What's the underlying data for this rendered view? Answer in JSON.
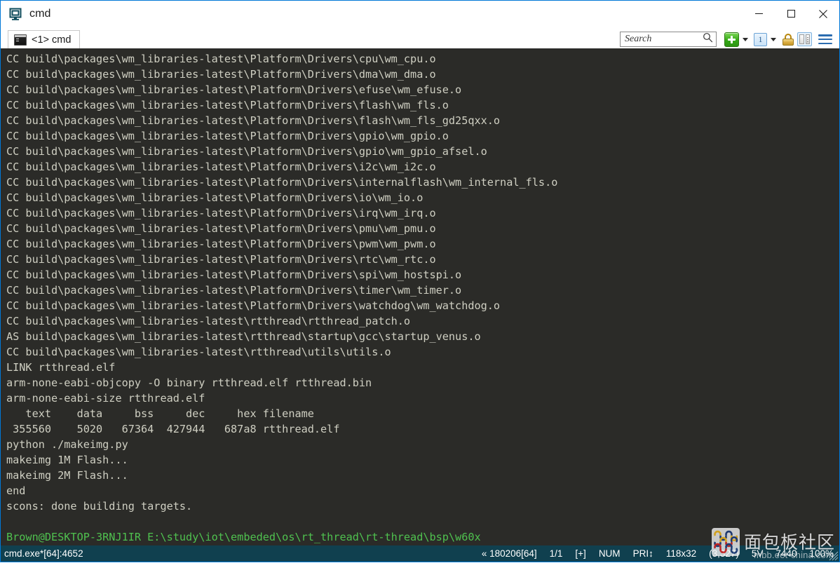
{
  "window": {
    "title": "cmd",
    "app_icon": "console-app-icon",
    "controls": {
      "minimize": "minimize-button",
      "maximize": "maximize-button",
      "close": "close-button"
    }
  },
  "tabs": [
    {
      "label": "<1> cmd",
      "icon": "console-tab-icon",
      "active": true
    }
  ],
  "toolbar": {
    "search": {
      "placeholder": "Search",
      "value": "",
      "icon": "search-icon"
    },
    "buttons": [
      {
        "name": "new-console-button",
        "icon": "plus-icon",
        "label": ""
      },
      {
        "name": "new-console-dropdown",
        "icon": "chevron-down-icon",
        "label": ""
      },
      {
        "name": "active-console-button",
        "icon": "console-number-icon",
        "label": "1"
      },
      {
        "name": "active-console-dropdown",
        "icon": "chevron-down-icon",
        "label": ""
      },
      {
        "name": "lock-button",
        "icon": "lock-icon",
        "label": ""
      },
      {
        "name": "split-view-button",
        "icon": "split-panes-icon",
        "label": ""
      },
      {
        "name": "main-menu-button",
        "icon": "hamburger-menu-icon",
        "label": ""
      }
    ]
  },
  "terminal": {
    "colors": {
      "background": "#2b2b28",
      "foreground": "#cfcfc2",
      "prompt": "#4fc14f"
    },
    "lines": [
      {
        "text": "CC build\\packages\\wm_libraries-latest\\Platform\\Drivers\\cpu\\wm_cpu.o",
        "style": "normal"
      },
      {
        "text": "CC build\\packages\\wm_libraries-latest\\Platform\\Drivers\\dma\\wm_dma.o",
        "style": "normal"
      },
      {
        "text": "CC build\\packages\\wm_libraries-latest\\Platform\\Drivers\\efuse\\wm_efuse.o",
        "style": "normal"
      },
      {
        "text": "CC build\\packages\\wm_libraries-latest\\Platform\\Drivers\\flash\\wm_fls.o",
        "style": "normal"
      },
      {
        "text": "CC build\\packages\\wm_libraries-latest\\Platform\\Drivers\\flash\\wm_fls_gd25qxx.o",
        "style": "normal"
      },
      {
        "text": "CC build\\packages\\wm_libraries-latest\\Platform\\Drivers\\gpio\\wm_gpio.o",
        "style": "normal"
      },
      {
        "text": "CC build\\packages\\wm_libraries-latest\\Platform\\Drivers\\gpio\\wm_gpio_afsel.o",
        "style": "normal"
      },
      {
        "text": "CC build\\packages\\wm_libraries-latest\\Platform\\Drivers\\i2c\\wm_i2c.o",
        "style": "normal"
      },
      {
        "text": "CC build\\packages\\wm_libraries-latest\\Platform\\Drivers\\internalflash\\wm_internal_fls.o",
        "style": "normal"
      },
      {
        "text": "CC build\\packages\\wm_libraries-latest\\Platform\\Drivers\\io\\wm_io.o",
        "style": "normal"
      },
      {
        "text": "CC build\\packages\\wm_libraries-latest\\Platform\\Drivers\\irq\\wm_irq.o",
        "style": "normal"
      },
      {
        "text": "CC build\\packages\\wm_libraries-latest\\Platform\\Drivers\\pmu\\wm_pmu.o",
        "style": "normal"
      },
      {
        "text": "CC build\\packages\\wm_libraries-latest\\Platform\\Drivers\\pwm\\wm_pwm.o",
        "style": "normal"
      },
      {
        "text": "CC build\\packages\\wm_libraries-latest\\Platform\\Drivers\\rtc\\wm_rtc.o",
        "style": "normal"
      },
      {
        "text": "CC build\\packages\\wm_libraries-latest\\Platform\\Drivers\\spi\\wm_hostspi.o",
        "style": "normal"
      },
      {
        "text": "CC build\\packages\\wm_libraries-latest\\Platform\\Drivers\\timer\\wm_timer.o",
        "style": "normal"
      },
      {
        "text": "CC build\\packages\\wm_libraries-latest\\Platform\\Drivers\\watchdog\\wm_watchdog.o",
        "style": "normal"
      },
      {
        "text": "CC build\\packages\\wm_libraries-latest\\rtthread\\rtthread_patch.o",
        "style": "normal"
      },
      {
        "text": "AS build\\packages\\wm_libraries-latest\\rtthread\\startup\\gcc\\startup_venus.o",
        "style": "normal"
      },
      {
        "text": "CC build\\packages\\wm_libraries-latest\\rtthread\\utils\\utils.o",
        "style": "normal"
      },
      {
        "text": "LINK rtthread.elf",
        "style": "normal"
      },
      {
        "text": "arm-none-eabi-objcopy -O binary rtthread.elf rtthread.bin",
        "style": "normal"
      },
      {
        "text": "arm-none-eabi-size rtthread.elf",
        "style": "normal"
      },
      {
        "text": "   text    data     bss     dec     hex filename",
        "style": "normal"
      },
      {
        "text": " 355560    5020   67364  427944   687a8 rtthread.elf",
        "style": "normal"
      },
      {
        "text": "python ./makeimg.py",
        "style": "normal"
      },
      {
        "text": "makeimg 1M Flash...",
        "style": "normal"
      },
      {
        "text": "makeimg 2M Flash...",
        "style": "normal"
      },
      {
        "text": "end",
        "style": "normal"
      },
      {
        "text": "scons: done building targets.",
        "style": "normal"
      },
      {
        "text": "",
        "style": "normal"
      },
      {
        "text": "Brown@DESKTOP-3RNJ1IR E:\\study\\iot\\embeded\\os\\rt_thread\\rt-thread\\bsp\\w60x",
        "style": "prompt"
      }
    ]
  },
  "statusbar": {
    "process": "cmd.exe*[64]:4652",
    "version": "« 180206[64]",
    "tab_index": "1/1",
    "insert_mode": "[+]",
    "num_lock": "NUM",
    "priority": "PRI↕",
    "size": "118x32",
    "cursor": "(3,327)",
    "voltage": "5V",
    "memory": "7440",
    "zoom": "100%"
  },
  "watermark": {
    "name": "面包板社区",
    "url": "mbb.eet-china.com"
  }
}
